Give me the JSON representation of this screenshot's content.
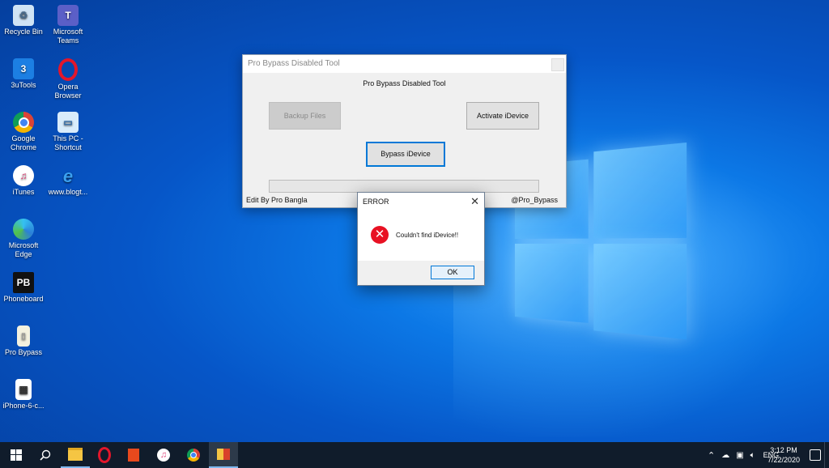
{
  "desktop": {
    "icons": [
      {
        "label": "Recycle Bin"
      },
      {
        "label": "Microsoft Teams"
      },
      {
        "label": "3uTools"
      },
      {
        "label": "Opera Browser"
      },
      {
        "label": "Google Chrome"
      },
      {
        "label": "This PC - Shortcut"
      },
      {
        "label": "iTunes"
      },
      {
        "label": "www.blogt..."
      },
      {
        "label": "Microsoft Edge"
      },
      {
        "label": "Phoneboard"
      },
      {
        "label": "Pro Bypass"
      },
      {
        "label": "iPhone-6-c..."
      }
    ]
  },
  "app": {
    "title": "Pro Bypass Disabled Tool",
    "heading": "Pro Bypass Disabled Tool",
    "backup_label": "Backup Files",
    "activate_label": "Activate iDevice",
    "bypass_label": "Bypass iDevice",
    "progress": 0,
    "footer_left": "Edit By Pro Bangla",
    "footer_right": "@Pro_Bypass"
  },
  "dialog": {
    "title": "ERROR",
    "message": "Couldn't find iDevice!!",
    "ok_label": "OK",
    "close_glyph": "✕",
    "error_glyph": "✕"
  },
  "taskbar": {
    "items": [
      "windows-start",
      "search",
      "file-explorer",
      "opera",
      "office",
      "itunes",
      "chrome",
      "pro-bypass"
    ],
    "tray": {
      "language": "ENG",
      "time": "3:12 PM",
      "date": "7/22/2020"
    }
  },
  "colors": {
    "accent": "#0078d7",
    "error": "#e81123",
    "taskbar": "#101c2b"
  }
}
